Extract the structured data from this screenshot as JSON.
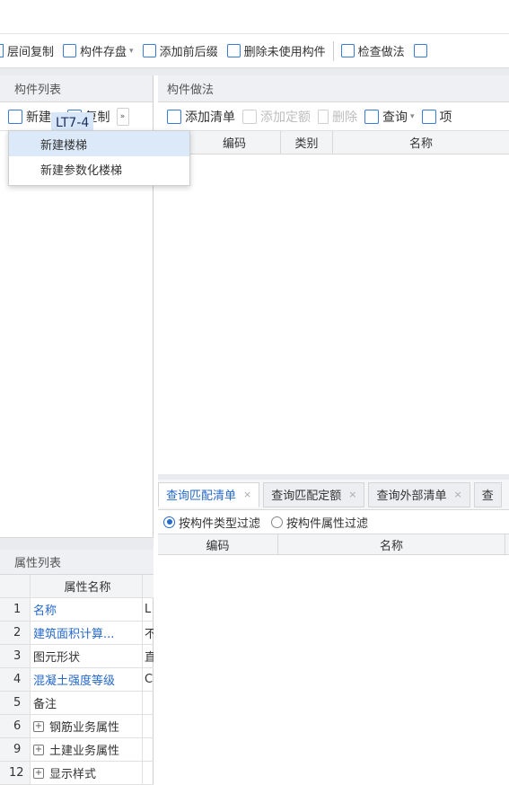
{
  "toolbar": {
    "items": [
      {
        "label": "层间复制",
        "icon": "copy-floor-icon"
      },
      {
        "label": "构件存盘",
        "icon": "save-component-icon",
        "has_caret": true
      },
      {
        "label": "添加前后缀",
        "icon": "add-affix-icon"
      },
      {
        "label": "删除未使用构件",
        "icon": "delete-unused-icon"
      },
      {
        "label": "检查做法",
        "icon": "check-method-icon"
      }
    ]
  },
  "component_list": {
    "title": "构件列表",
    "new_label": "新建",
    "copy_label": "复制",
    "selected_item": "LT7-4",
    "dropdown": [
      "新建楼梯",
      "新建参数化楼梯"
    ]
  },
  "properties": {
    "title": "属性列表",
    "header": "属性名称",
    "rows": [
      {
        "num": "1",
        "name": "名称",
        "value": "L",
        "blue": true
      },
      {
        "num": "2",
        "name": "建筑面积计算...",
        "value": "不",
        "blue": true
      },
      {
        "num": "3",
        "name": "图元形状",
        "value": "直",
        "blue": false
      },
      {
        "num": "4",
        "name": "混凝土强度等级",
        "value": "C",
        "blue": true
      },
      {
        "num": "5",
        "name": "备注",
        "value": "",
        "blue": false
      },
      {
        "num": "6",
        "name": "钢筋业务属性",
        "value": "",
        "blue": false,
        "expand": true
      },
      {
        "num": "9",
        "name": "土建业务属性",
        "value": "",
        "blue": false,
        "expand": true
      },
      {
        "num": "12",
        "name": "显示样式",
        "value": "",
        "blue": false,
        "expand": true
      }
    ]
  },
  "method": {
    "title": "构件做法",
    "buttons": [
      {
        "label": "添加清单",
        "disabled": false
      },
      {
        "label": "添加定额",
        "disabled": true
      },
      {
        "label": "删除",
        "disabled": true
      },
      {
        "label": "查询",
        "disabled": false,
        "caret": true
      },
      {
        "label": "项",
        "disabled": false
      }
    ],
    "columns": [
      "编码",
      "类别",
      "名称"
    ]
  },
  "query": {
    "tabs": [
      "查询匹配清单",
      "查询匹配定额",
      "查询外部清单",
      "查"
    ],
    "filter_type": "按构件类型过滤",
    "filter_attr": "按构件属性过滤",
    "columns": [
      "编码",
      "名称"
    ]
  }
}
